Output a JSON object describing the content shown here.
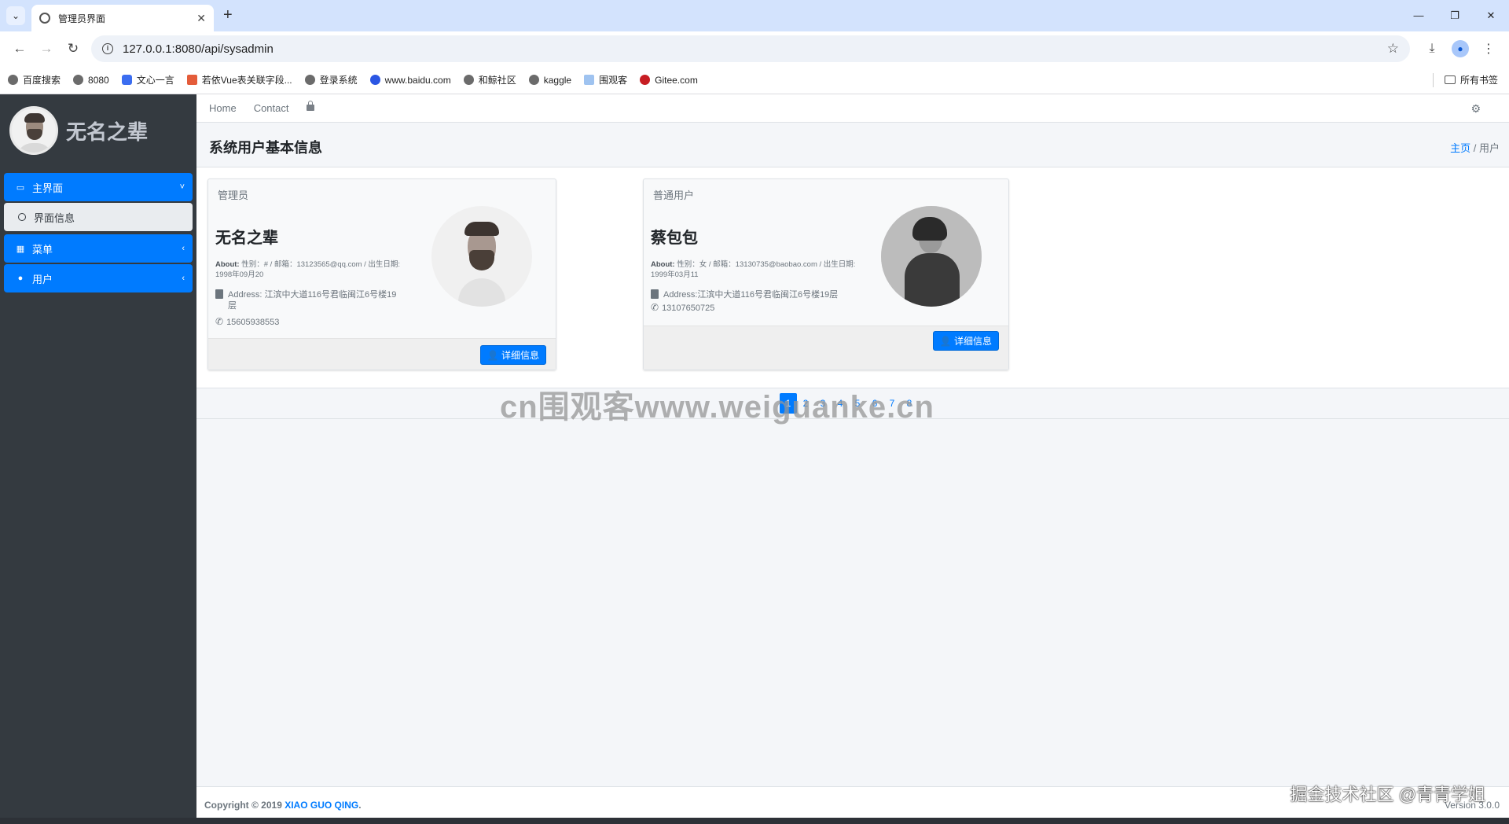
{
  "browser": {
    "tab_title": "管理员界面",
    "url": "127.0.0.1:8080/api/sysadmin",
    "bookmarks": [
      "百度搜索",
      "8080",
      "文心一言",
      "若依Vue表关联字段...",
      "登录系统",
      "www.baidu.com",
      "和鲸社区",
      "kaggle",
      "围观客",
      "Gitee.com"
    ],
    "all_bookmarks": "所有书签"
  },
  "sidebar": {
    "brand_name": "无名之辈",
    "menu": [
      {
        "label": "主界面",
        "icon": "monitor-icon"
      },
      {
        "label": "界面信息",
        "icon": "circle-icon"
      },
      {
        "label": "菜单",
        "icon": "table-icon"
      },
      {
        "label": "用户",
        "icon": "user-icon"
      }
    ]
  },
  "topnav": {
    "home": "Home",
    "contact": "Contact"
  },
  "page": {
    "title": "系统用户基本信息",
    "breadcrumb_home": "主页",
    "breadcrumb_current": "用户"
  },
  "cards": [
    {
      "role": "管理员",
      "name": "无名之辈",
      "about_label": "About:",
      "about_line1": "性别：# / 邮箱：13123565@qq.com / 出生日期:",
      "about_line2": "1998年09月20",
      "address_line1": "Address: 江滨中大道116号君临闽江6号楼19",
      "address_line2": "层",
      "phone": "15605938553",
      "button": "详细信息"
    },
    {
      "role": "普通用户",
      "name": "蔡包包",
      "about_label": "About:",
      "about_line1": "性别：女 / 邮箱：13130735@baobao.com / 出生日期:",
      "about_line2": "1999年03月11",
      "address_line1": "Address:江滨中大道116号君临闽江6号楼19层",
      "phone": "13107650725",
      "button": "详细信息"
    }
  ],
  "pagination": [
    "1",
    "2",
    "3",
    "4",
    "5",
    "6",
    "7",
    "8"
  ],
  "watermark": "cn围观客www.weiguanke.cn",
  "footer": {
    "copyright": "Copyright © 2019 ",
    "author": "XIAO GUO QING",
    "period": ".",
    "version": "Version 3.0.0",
    "watermark2": "掘金技术社区 @青青学姐"
  },
  "colors": {
    "primary": "#007bff",
    "sidebar": "#343a40"
  }
}
